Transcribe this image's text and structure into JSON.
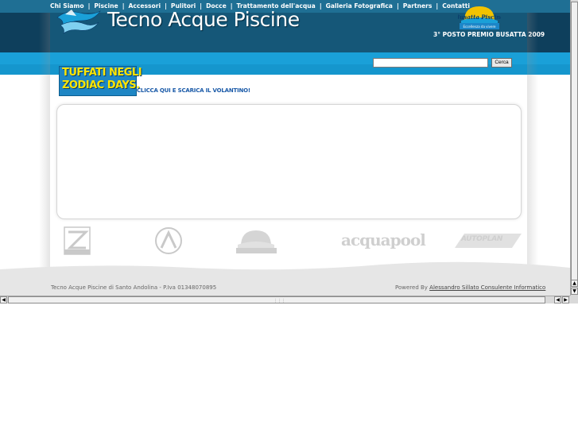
{
  "nav": {
    "items": [
      "Chi Siamo",
      "Piscine",
      "Accessori",
      "Pulitori",
      "Docce",
      "Trattamento dell'acqua",
      "Galleria Fotografica",
      "Partners",
      "Contatti"
    ],
    "separator": "|"
  },
  "header": {
    "title": "Tecno Acque Piscine",
    "award_badge_text": "Busatta Piscine",
    "award_badge_sub": "Eccellenza da vivere",
    "award_text": "3° POSTO PREMIO BUSATTA 2009"
  },
  "search": {
    "value": "",
    "button_label": "Cerca"
  },
  "promo": {
    "line1": "TUFFATI NEGLI",
    "line2": "ZODIAC DAYS.",
    "cta": "CLICCA QUI E SCARICA IL VOLANTINO!"
  },
  "partners": {
    "acquapool": "acquapool",
    "autoplan": "AUTOPLAN"
  },
  "footer": {
    "left": "Tecno Acque Piscine di Santo Andolina - P.Iva 01348070895",
    "powered_by": "Powered By",
    "credit_link": "Alessandro Sillato Consulente Informatico"
  },
  "colors": {
    "nav_bg": "#1f6f94",
    "header_bg": "#155778",
    "band_bg": "#1aa0d8",
    "promo_yellow": "#ffe500",
    "footer_bg": "#e6e6e6"
  },
  "icons": [
    "logo-wave-icon",
    "busatta-badge-icon",
    "zodiac-logo-icon",
    "astral-logo-icon",
    "busatta-partner-icon"
  ]
}
